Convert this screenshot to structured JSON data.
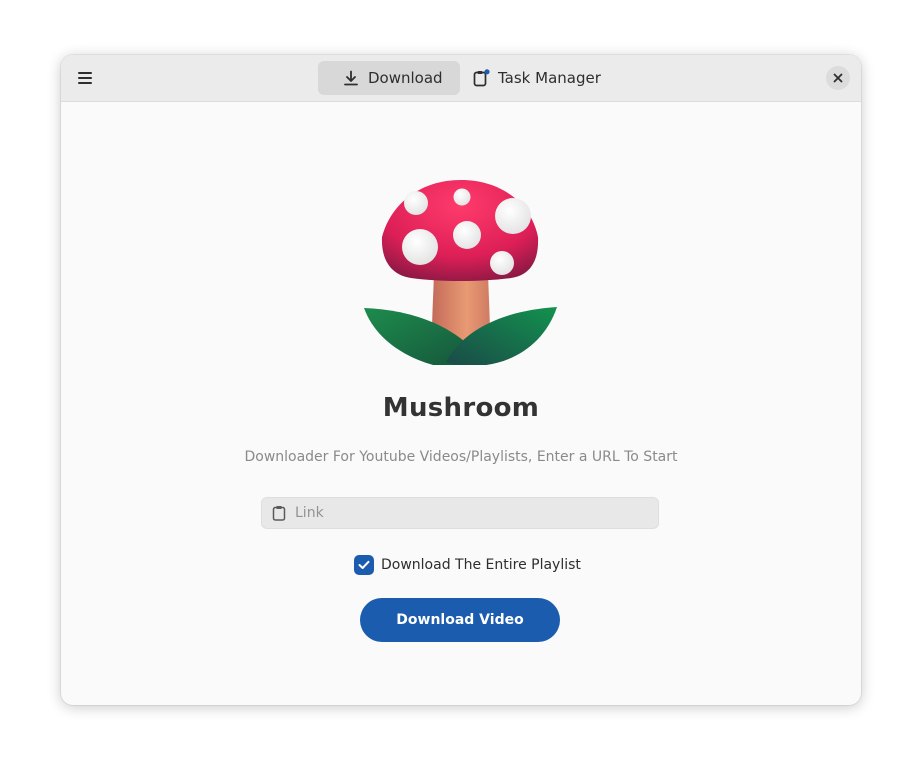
{
  "header": {
    "menu_icon": "hamburger-icon",
    "tabs": [
      {
        "label": "Download",
        "icon": "download-icon",
        "active": true
      },
      {
        "label": "Task Manager",
        "icon": "clipboard-icon",
        "active": false,
        "badge_color": "#1c5cae"
      }
    ],
    "close_icon": "close-icon"
  },
  "main": {
    "app_name": "Mushroom",
    "subtitle": "Downloader For Youtube Videos/Playlists, Enter a URL To Start",
    "link_entry": {
      "placeholder": "Link",
      "value": "",
      "icon": "paste-icon"
    },
    "playlist_checkbox": {
      "label": "Download The Entire Playlist",
      "checked": true
    },
    "download_button": "Download Video"
  },
  "colors": {
    "accent": "#1c5cae",
    "mushroom_cap": "#e0245e",
    "leaf": "#1f7a4a",
    "window_bg": "#fafafa",
    "header_bg": "#ebebeb"
  }
}
